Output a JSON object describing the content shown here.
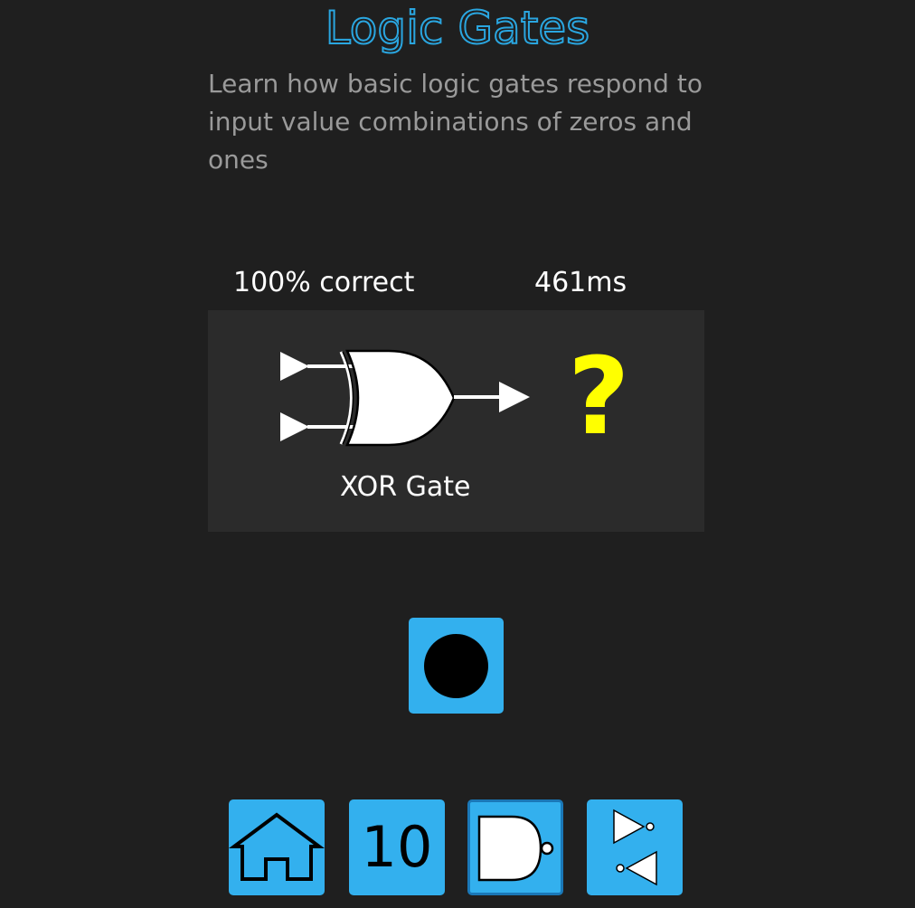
{
  "header": {
    "title": "Logic Gates",
    "description": "Learn how basic logic gates respond to input value combinations of zeros and ones"
  },
  "stats": {
    "correct": "100% correct",
    "time": "461ms"
  },
  "gate": {
    "name": "XOR Gate",
    "output": "?"
  },
  "nav": {
    "count": "10"
  },
  "colors": {
    "background": "#1f1f1f",
    "panel": "#2b2b2b",
    "accent": "#33b0ee",
    "title": "#2aa6e0",
    "output_unknown": "#ffff00"
  },
  "icons": {
    "home": "home-icon",
    "gate": "nand-gate-icon",
    "buffers": "not-gates-icon",
    "input": "input-dot-icon"
  }
}
